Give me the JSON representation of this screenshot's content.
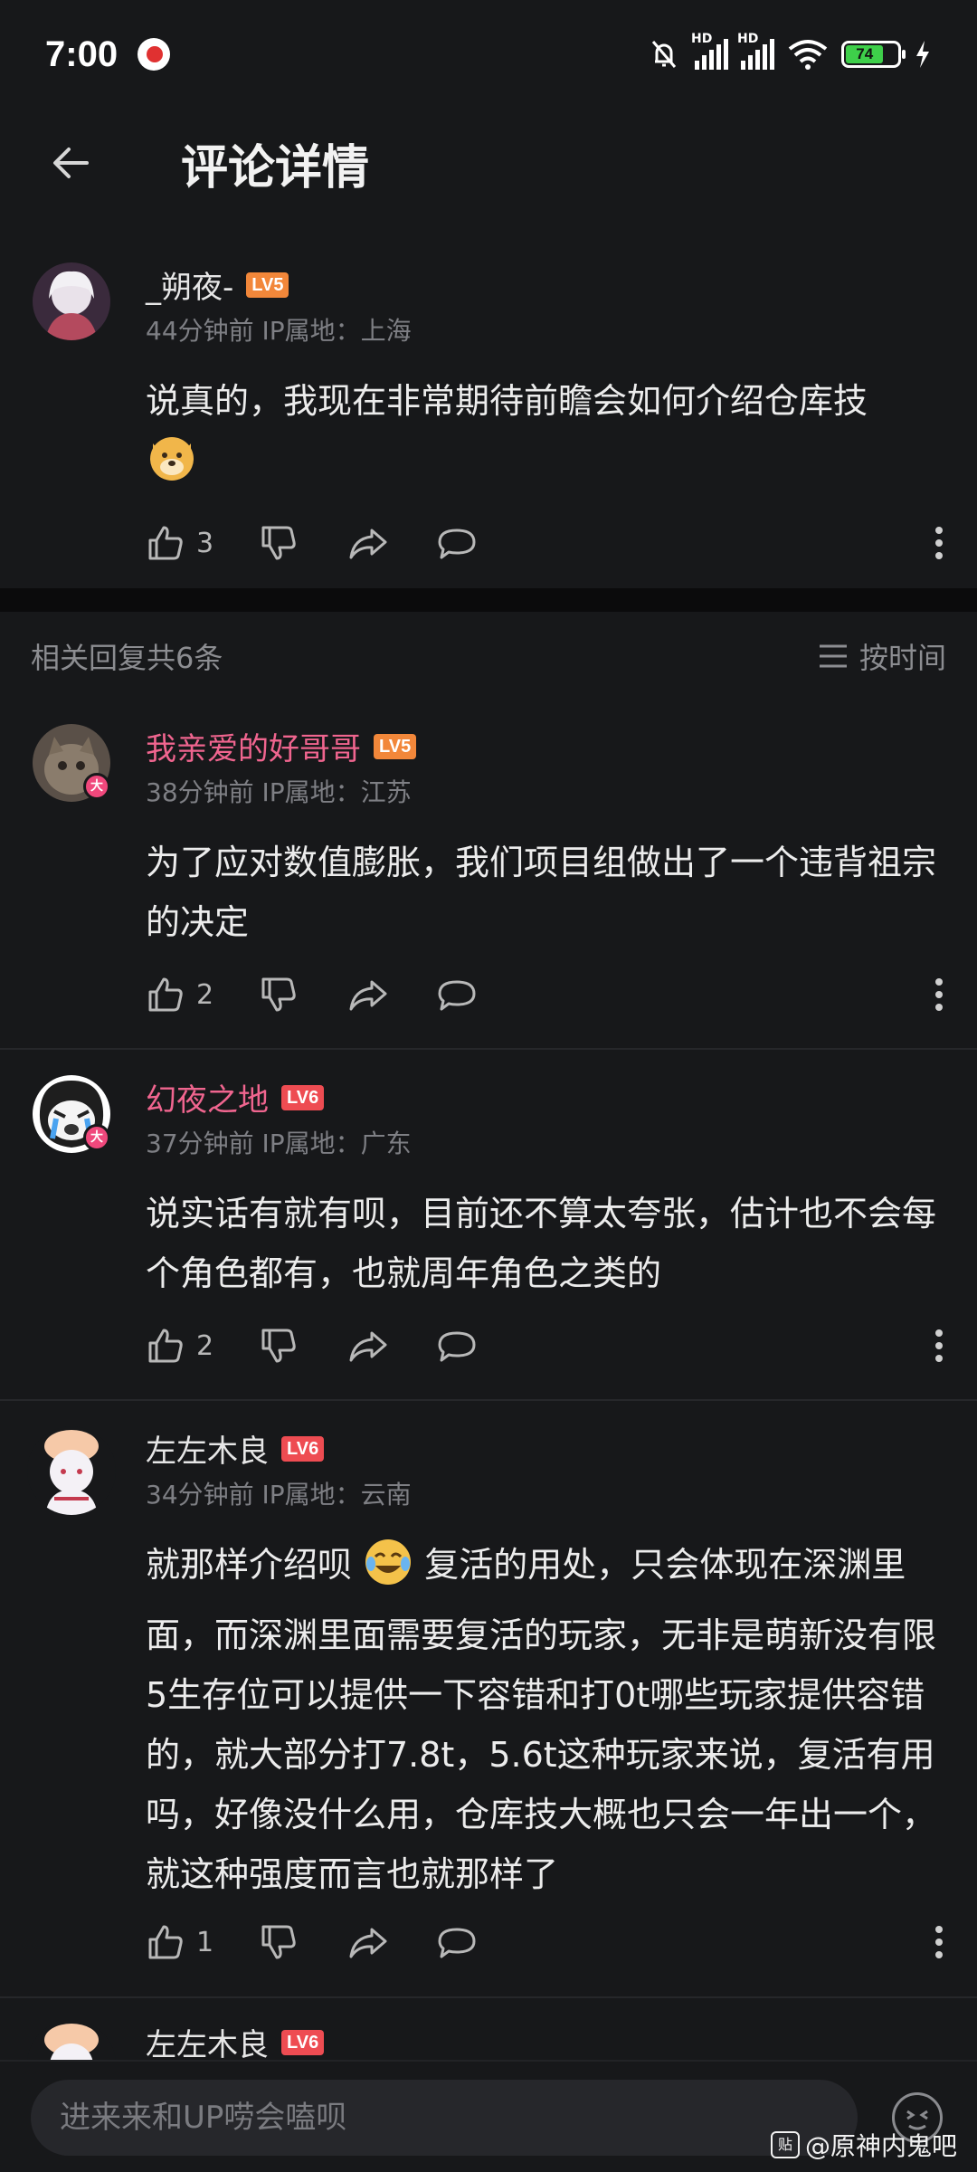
{
  "status_bar": {
    "time": "7:00",
    "battery": "74",
    "hd1": "HD",
    "hd2": "HD"
  },
  "header": {
    "title": "评论详情"
  },
  "main_comment": {
    "username": "_朔夜-",
    "level": "LV5",
    "meta": "44分钟前 IP属地：上海",
    "content": "说真的，我现在非常期待前瞻会如何介绍仓库技",
    "likes": "3"
  },
  "replies_header": {
    "count_label": "相关回复共6条",
    "sort_label": "按时间"
  },
  "replies": [
    {
      "username": "我亲爱的好哥哥",
      "level": "LV5",
      "badge": "大",
      "meta": "38分钟前 IP属地：江苏",
      "content": "为了应对数值膨胀，我们项目组做出了一个违背祖宗的决定",
      "likes": "2"
    },
    {
      "username": "幻夜之地",
      "level": "LV6",
      "badge": "大",
      "meta": "37分钟前 IP属地：广东",
      "content": "说实话有就有呗，目前还不算太夸张，估计也不会每个角色都有，也就周年角色之类的",
      "likes": "2"
    },
    {
      "username": "左左木良",
      "level": "LV6",
      "meta": "34分钟前 IP属地：云南",
      "content_before_emoji": "就那样介绍呗",
      "content_after_emoji": "复活的用处，只会体现在深渊里面，而深渊里面需要复活的玩家，无非是萌新没有限5生存位可以提供一下容错和打0t哪些玩家提供容错的，就大部分打7.8t，5.6t这种玩家来说，复活有用吗，好像没什么用，仓库技大概也只会一年出一个，就这种强度而言也就那样了",
      "likes": "1"
    },
    {
      "username": "左左木良",
      "level": "LV6"
    }
  ],
  "bottom_bar": {
    "input_placeholder": "进来来和UP唠会嗑呗"
  },
  "watermark": {
    "icon_text": "贴",
    "text": "@原神内鬼吧"
  },
  "colors": {
    "background": "#17181a",
    "username_pink": "#f0658f",
    "level_orange": "#f2873a",
    "level_red": "#ee4c52"
  }
}
